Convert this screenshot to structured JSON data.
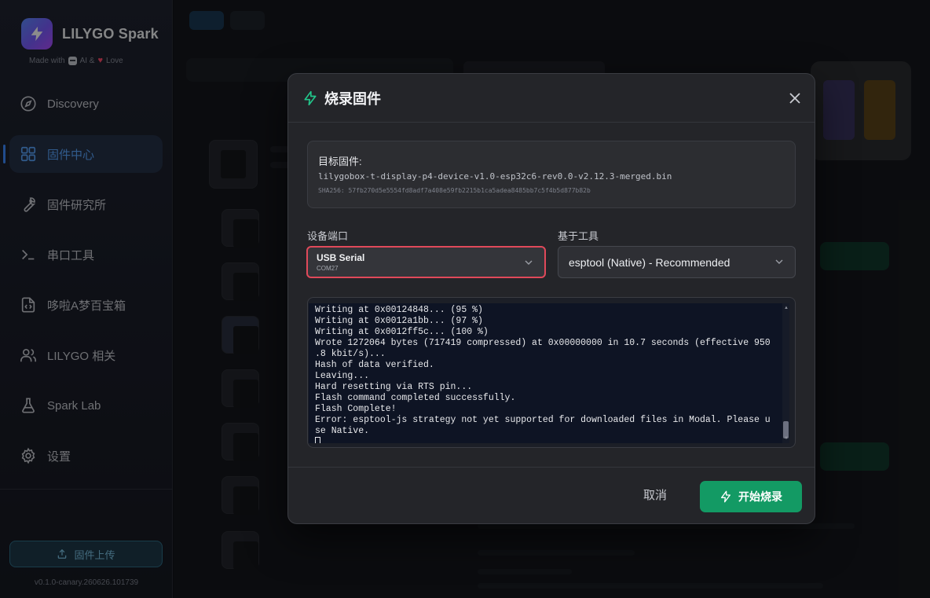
{
  "app": {
    "name": "LILYGO Spark",
    "tagline_prefix": "Made with",
    "tagline_ai": "AI &",
    "tagline_love": "Love",
    "version": "v0.1.0-canary.260626.101739"
  },
  "sidebar": {
    "items": [
      {
        "label": "Discovery",
        "icon": "compass-icon",
        "active": false
      },
      {
        "label": "固件中心",
        "icon": "grid-icon",
        "active": true
      },
      {
        "label": "固件研究所",
        "icon": "wrench-icon",
        "active": false
      },
      {
        "label": "串口工具",
        "icon": "terminal-icon",
        "active": false
      },
      {
        "label": "哆啦A梦百宝箱",
        "icon": "code-file-icon",
        "active": false
      },
      {
        "label": "LILYGO 相关",
        "icon": "users-icon",
        "active": false
      },
      {
        "label": "Spark Lab",
        "icon": "flask-icon",
        "active": false
      },
      {
        "label": "设置",
        "icon": "gear-icon",
        "active": false
      }
    ],
    "upload_label": "固件上传"
  },
  "modal": {
    "title": "烧录固件",
    "firmware_label": "目标固件:",
    "firmware_name": "lilygobox-t-display-p4-device-v1.0-esp32c6-rev0.0-v2.12.3-merged.bin",
    "firmware_sha": "SHA256: 57fb270d5e5554fd8adf7a408e59fb2215b1ca5adea8485bb7c5f4b5d877b82b",
    "port_label": "设备端口",
    "port_value": "USB Serial",
    "port_sub": "COM27",
    "tool_label": "基于工具",
    "tool_value": "esptool (Native) - Recommended",
    "console_lines": [
      "Writing at 0x00124848... (95 %)",
      "Writing at 0x0012a1bb... (97 %)",
      "Writing at 0x0012ff5c... (100 %)",
      "Wrote 1272064 bytes (717419 compressed) at 0x00000000 in 10.7 seconds (effective 950",
      ".8 kbit/s)...",
      "Hash of data verified.",
      "Leaving...",
      "Hard resetting via RTS pin...",
      "Flash command completed successfully.",
      "Flash Complete!",
      "Error: esptool-js strategy not yet supported for downloaded files in Modal. Please u",
      "se Native."
    ],
    "cancel_label": "取消",
    "start_label": "开始烧录"
  },
  "colors": {
    "accent_blue": "#3d8bff",
    "start_green": "#139a64",
    "highlight_red": "#e0495a",
    "console_bg": "#0e1424"
  }
}
